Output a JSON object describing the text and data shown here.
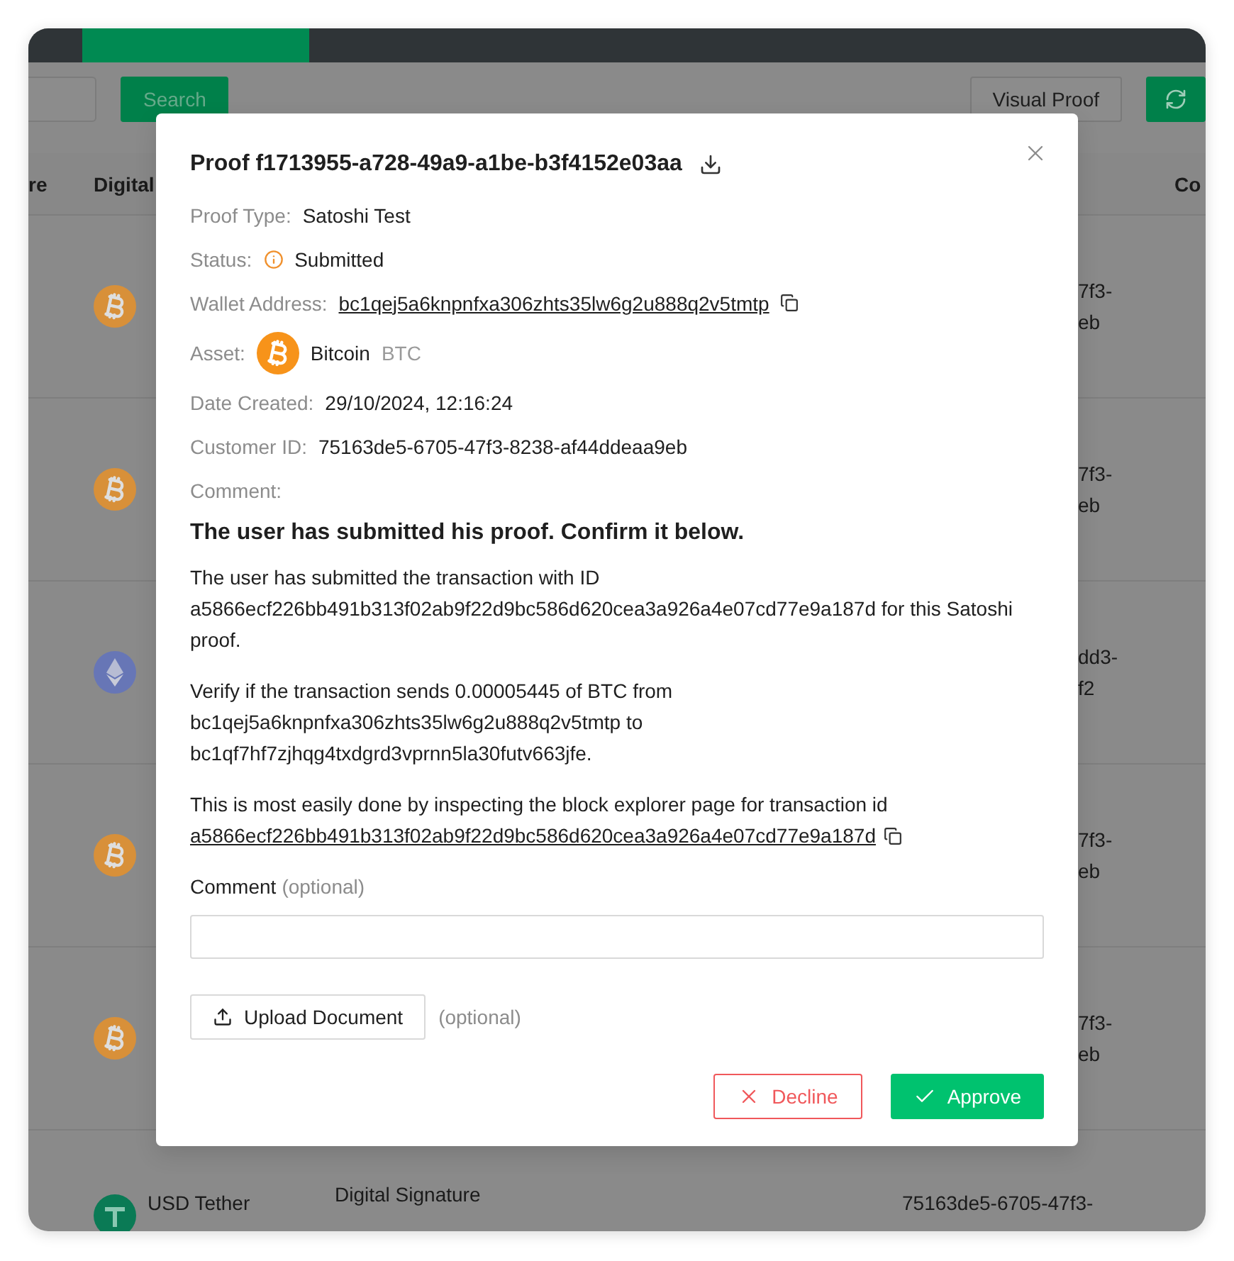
{
  "toolbar": {
    "search_button": "Search",
    "visual_proof_button": "Visual Proof"
  },
  "table": {
    "columns": [
      "re",
      "Digital",
      "Co"
    ],
    "rows": [
      {
        "kind": "bitcoin",
        "customer_line1": "7f3-",
        "customer_line2": "eb"
      },
      {
        "kind": "bitcoin",
        "customer_line1": "7f3-",
        "customer_line2": "eb"
      },
      {
        "kind": "ethereum",
        "customer_line1": "dd3-",
        "customer_line2": "f2"
      },
      {
        "kind": "bitcoin",
        "customer_line1": "7f3-",
        "customer_line2": "eb"
      },
      {
        "kind": "bitcoin",
        "customer_line1": "7f3-",
        "customer_line2": "eb"
      }
    ],
    "partial_row": {
      "kind": "tether",
      "name": "USD Tether",
      "type": "Digital Signature",
      "customer": "75163de5-6705-47f3-"
    }
  },
  "modal": {
    "title": "Proof f1713955-a728-49a9-a1be-b3f4152e03aa",
    "details": [
      {
        "kind": "text",
        "label": "Proof Type:",
        "value": "Satoshi Test"
      },
      {
        "kind": "status",
        "label": "Status:",
        "value": "Submitted"
      },
      {
        "kind": "link",
        "label": "Wallet Address:",
        "value": "bc1qej5a6knpnfxa306zhts35lw6g2u888q2v5tmtp"
      },
      {
        "kind": "asset",
        "label": "Asset:",
        "value": "Bitcoin",
        "code": "BTC"
      },
      {
        "kind": "text",
        "label": "Date Created:",
        "value": "29/10/2024, 12:16:24"
      },
      {
        "kind": "text",
        "label": "Customer ID:",
        "value": "75163de5-6705-47f3-8238-af44ddeaa9eb"
      },
      {
        "kind": "text",
        "label": "Comment:"
      }
    ],
    "heading": "The user has submitted his proof. Confirm it below.",
    "paragraphs": [
      "The user has submitted the transaction with ID a5866ecf226bb491b313f02ab9f22d9bc586d620cea3a926a4e07cd77e9a187d for this Satoshi proof.",
      "Verify if the transaction sends 0.00005445 of BTC from bc1qej5a6knpnfxa306zhts35lw6g2u888q2v5tmtp to bc1qf7hf7zjhqg4txdgrd3vprnn5la30futv663jfe."
    ],
    "explorer": {
      "text": "This is most easily done by inspecting the block explorer page for transaction id",
      "link": "a5866ecf226bb491b313f02ab9f22d9bc586d620cea3a926a4e07cd77e9a187d"
    },
    "comment_field": {
      "label": "Comment",
      "hint": "(optional)"
    },
    "upload": {
      "label": "Upload Document",
      "hint": "(optional)"
    },
    "buttons": [
      {
        "kind": "decline",
        "label": "Decline"
      },
      {
        "kind": "approve",
        "label": "Approve"
      }
    ]
  }
}
